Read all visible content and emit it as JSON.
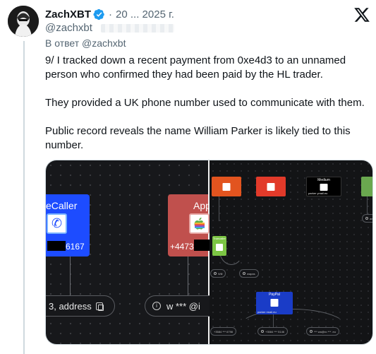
{
  "tweet": {
    "author_name": "ZachXBT",
    "date": "20 ... 2025 г.",
    "handle": "@zachxbt",
    "reply_to": "В ответ @zachxbt",
    "paragraphs": [
      "9/ I tracked down a recent payment from  0xe4d3 to an unnamed person who confirmed they had been paid by the HL trader.",
      "They provided a UK phone number used to communicate with them.",
      "Public record reveals the name William Parker is likely tied to this number."
    ]
  },
  "icons": {
    "verified": "verified-badge-icon",
    "platform": "x-logo-icon"
  },
  "colors": {
    "verified_blue": "#1d9bf0",
    "truecaller_blue": "#1d4cff",
    "apple_red": "#c0504d",
    "media_bg": "#17181b"
  },
  "media": {
    "left_panel": {
      "truecaller_title": "eCaller",
      "truecaller_number": "6167",
      "apple_title": "App",
      "apple_number": "+4473",
      "chip_left": "3, address",
      "chip_right": "w *** @i"
    },
    "right_panel": {
      "nodes": [
        {
          "label": "",
          "sub": "",
          "color": "#e2541f"
        },
        {
          "label": "",
          "sub": "",
          "color": "#e23a2a"
        },
        {
          "label": "Medium",
          "sub": "parker  ymail.eu",
          "color": "#000000"
        },
        {
          "label": "",
          "sub": "",
          "color": "#6aa84f"
        },
        {
          "label": "PayPal",
          "sub": "parker   rmail.eu",
          "color": "#1a3cc7"
        }
      ],
      "green_node_label": "Truecaller",
      "pills": [
        "Will",
        "wapas",
        "+3584 *** 6798",
        "+3584 *** 5146",
        "*** wa@ro *** .eu",
        "am"
      ],
      "small_texts": [
        "ail.eu",
        "mail.eu"
      ]
    }
  }
}
